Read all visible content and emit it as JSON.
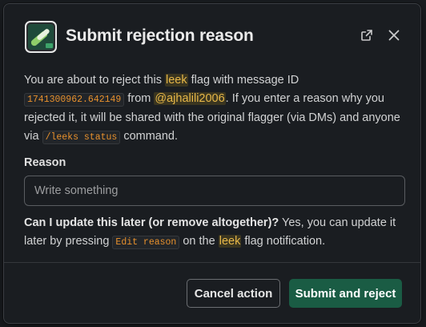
{
  "dialog": {
    "title": "Submit rejection reason",
    "intro": {
      "part1": "You are about to reject this ",
      "flag_word": "leek",
      "part2": " flag with message ID ",
      "message_id": "1741300962.642149",
      "part3": " from ",
      "user": "@ajhalili2006",
      "part4": ". If you enter a reason why you rejected it, it will be shared with the original flagger (via DMs) and anyone via ",
      "command": "/leeks status",
      "part5": " command."
    },
    "reason": {
      "label": "Reason",
      "placeholder": "Write something",
      "value": ""
    },
    "help": {
      "question": "Can I update this later (or remove altogether)?",
      "answer1": " Yes, you can update it later by pressing ",
      "button_ref": "Edit reason",
      "answer2": " on the ",
      "flag_word": "leek",
      "answer3": " flag notification."
    },
    "buttons": {
      "cancel": "Cancel action",
      "submit": "Submit and reject"
    },
    "icons": {
      "app": "leek-app-icon",
      "open": "open-in-new-window-icon",
      "close": "close-icon"
    },
    "colors": {
      "background": "#1a1d21",
      "highlight": "#e8b848",
      "code": "#e8912d",
      "submit": "#1a5c44"
    }
  }
}
